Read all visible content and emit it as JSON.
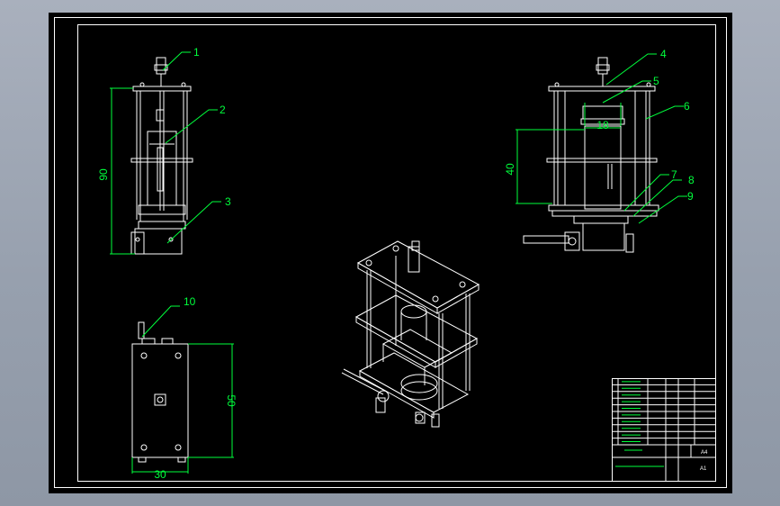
{
  "application": "CAD drawing viewer",
  "balloon_labels": [
    "1",
    "2",
    "3",
    "4",
    "5",
    "6",
    "7",
    "8",
    "9",
    "10"
  ],
  "dimensions": {
    "front_height": "90",
    "side_height": "40",
    "side_width": "18",
    "plan_height": "50",
    "plan_width": "30"
  },
  "title_block": {
    "sheet_size": "A4",
    "scale_cell": "A1"
  },
  "colors": {
    "background": "#000000",
    "geometry": "#ffffff",
    "annotation": "#00ff3c",
    "hidden": "#ff2a2a",
    "window": "#a9b0bd"
  }
}
